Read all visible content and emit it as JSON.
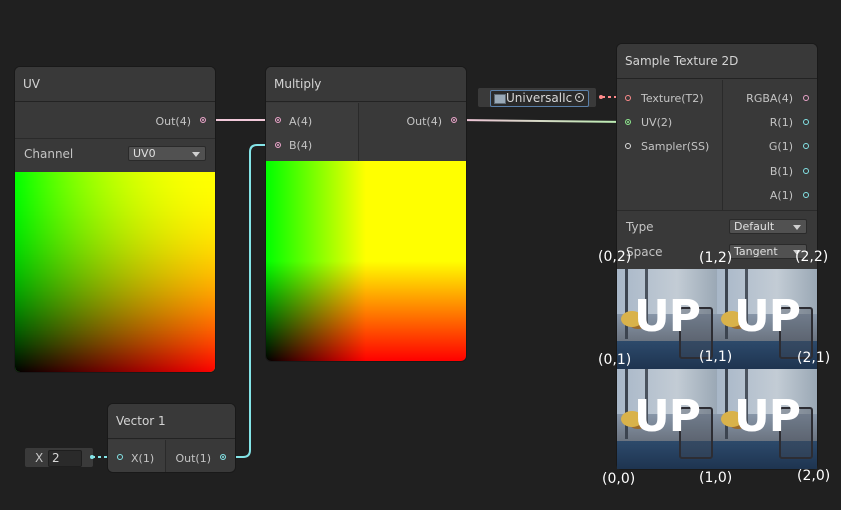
{
  "uv_node": {
    "title": "UV",
    "out_label": "Out(4)",
    "channel_label": "Channel",
    "channel_value": "UV0"
  },
  "multiply_node": {
    "title": "Multiply",
    "in_a": "A(4)",
    "in_b": "B(4)",
    "out_label": "Out(4)"
  },
  "vector1_node": {
    "title": "Vector 1",
    "in_x": "X(1)",
    "out_label": "Out(1)",
    "field_label": "X",
    "field_value": "2"
  },
  "texture_input": {
    "label": "UniversalIc"
  },
  "sample_node": {
    "title": "Sample Texture 2D",
    "inputs": [
      "Texture(T2)",
      "UV(2)",
      "Sampler(SS)"
    ],
    "outputs": [
      "RGBA(4)",
      "R(1)",
      "G(1)",
      "B(1)",
      "A(1)"
    ],
    "type_label": "Type",
    "type_value": "Default",
    "space_label": "Space",
    "space_value": "Tangent",
    "tile_text": "UP"
  },
  "coords": {
    "c02": "(0,2)",
    "c12": "(1,2)",
    "c22": "(2,2)",
    "c01": "(0,1)",
    "c11": "(1,1)",
    "c21": "(2,1)",
    "c00": "(0,0)",
    "c10": "(1,0)",
    "c20": "(2,0)"
  },
  "colors": {
    "vector4_port": "#e8a3c8",
    "vector2_port": "#8ee68e",
    "vector1_port": "#84e4e7",
    "texture_port": "#ff8b8b",
    "sampler_port": "#dcdcdc",
    "background": "#202020",
    "node_body": "#393939"
  }
}
